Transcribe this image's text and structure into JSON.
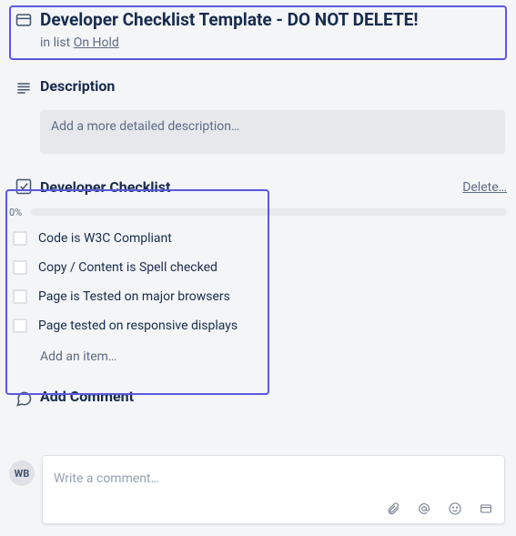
{
  "header": {
    "title": "Developer Checklist Template - DO NOT DELETE!",
    "in_list_prefix": "in list ",
    "list_name": "On Hold"
  },
  "description": {
    "title": "Description",
    "placeholder": "Add a more detailed description…"
  },
  "checklist": {
    "title": "Developer Checklist",
    "delete_label": "Delete…",
    "progress_percent": "0%",
    "items": [
      "Code is W3C Compliant",
      "Copy / Content is Spell checked",
      "Page is Tested on major browsers",
      "Page tested on responsive displays"
    ],
    "add_item_label": "Add an item…"
  },
  "comment": {
    "title": "Add Comment",
    "avatar_initials": "WB",
    "placeholder": "Write a comment…"
  }
}
